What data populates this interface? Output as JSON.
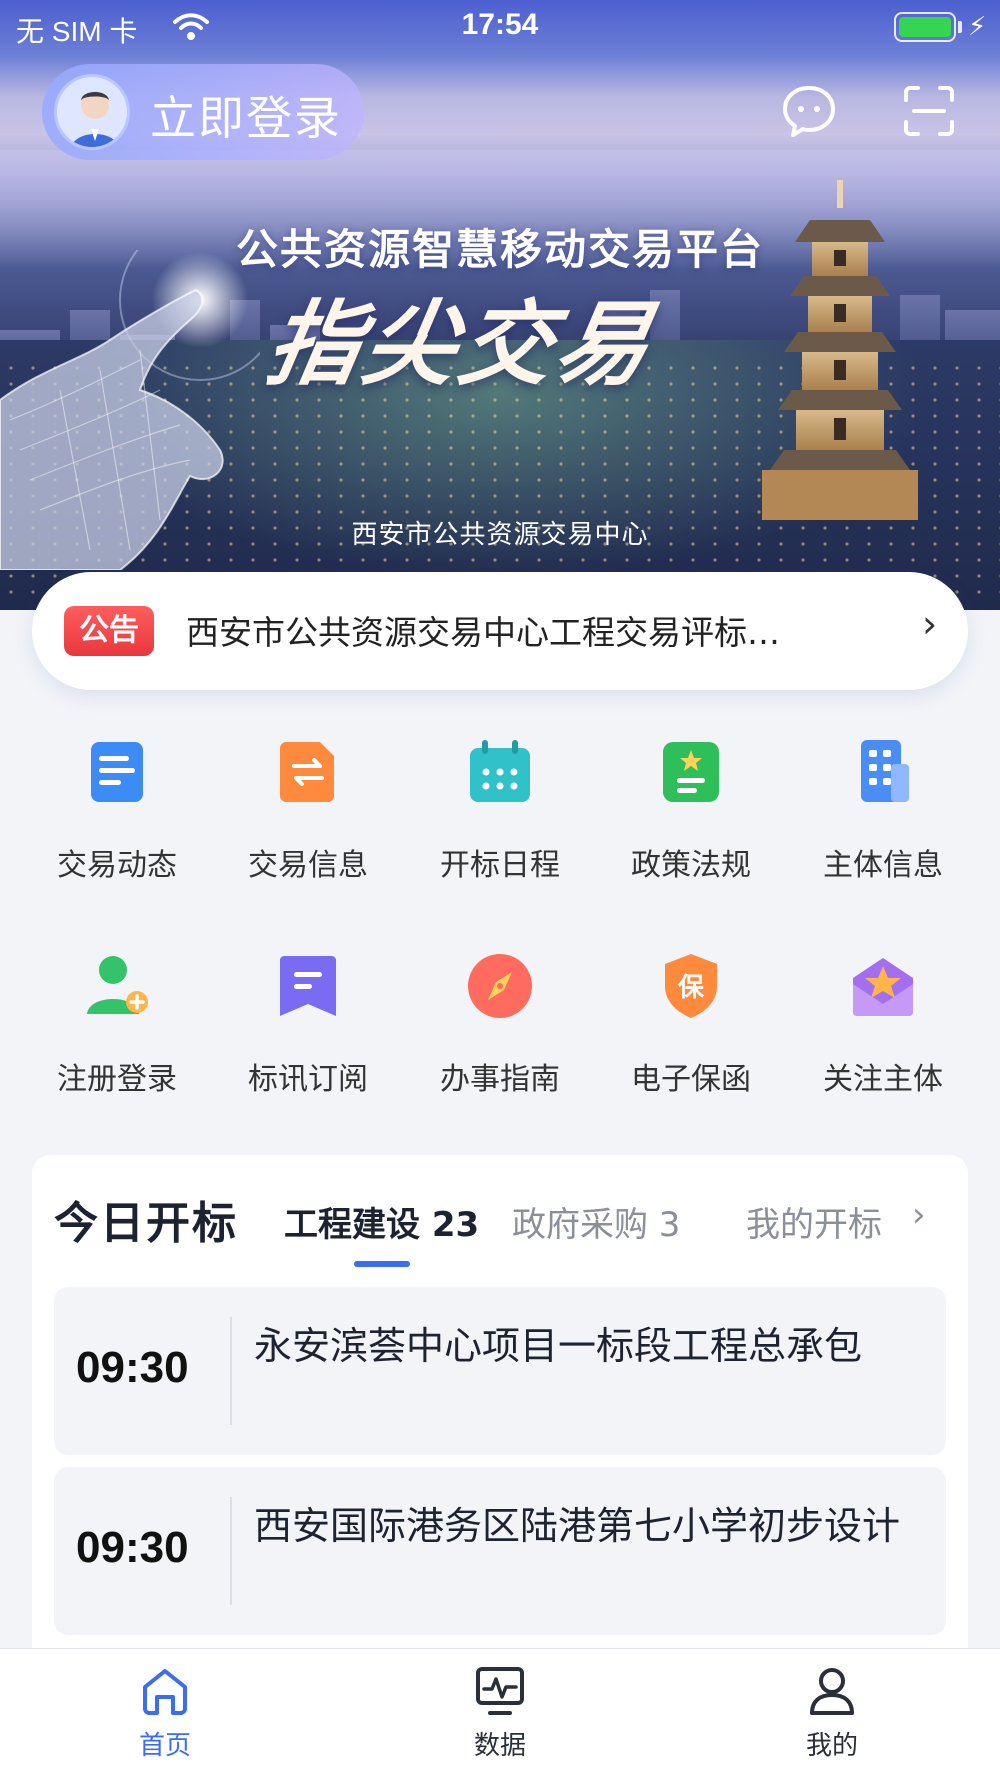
{
  "status_bar": {
    "carrier": "无 SIM 卡",
    "time": "17:54",
    "battery_color": "#35d453"
  },
  "header": {
    "login_label": "立即登录",
    "icons": [
      "message-icon",
      "scan-icon"
    ]
  },
  "banner": {
    "title": "公共资源智慧移动交易平台",
    "slogan": "指尖交易",
    "subtitle": "西安市公共资源交易中心"
  },
  "notice": {
    "badge": "公告",
    "text": "西安市公共资源交易中心工程交易评标…"
  },
  "grid": {
    "items": [
      {
        "label": "交易动态",
        "icon": "news-doc-icon",
        "color": "#3d8cf5"
      },
      {
        "label": "交易信息",
        "icon": "exchange-doc-icon",
        "color": "#ff8a3d"
      },
      {
        "label": "开标日程",
        "icon": "calendar-icon",
        "color": "#30c2c8"
      },
      {
        "label": "政策法规",
        "icon": "policy-badge-icon",
        "color": "#2fbf5a"
      },
      {
        "label": "主体信息",
        "icon": "building-icon",
        "color": "#4b8df6"
      },
      {
        "label": "注册登录",
        "icon": "add-user-icon",
        "color": "#34c26a"
      },
      {
        "label": "标讯订阅",
        "icon": "bookmark-icon",
        "color": "#7a6cf2"
      },
      {
        "label": "办事指南",
        "icon": "compass-icon",
        "color": "#ff6b5e"
      },
      {
        "label": "电子保函",
        "icon": "guarantee-shield-icon",
        "color": "#ff8a3d"
      },
      {
        "label": "关注主体",
        "icon": "star-envelope-icon",
        "color": "#a46ef0"
      }
    ]
  },
  "today": {
    "title": "今日开标",
    "tabs": [
      {
        "label": "工程建设 23",
        "active": true
      },
      {
        "label": "政府采购 3",
        "active": false
      }
    ],
    "mine_link": "我的开标",
    "accent": "#3a6cf4",
    "rows": [
      {
        "time": "09:30",
        "title": "永安滨荟中心项目一标段工程总承包"
      },
      {
        "time": "09:30",
        "title": "西安国际港务区陆港第七小学初步设计"
      }
    ]
  },
  "tabbar": {
    "items": [
      {
        "label": "首页",
        "icon": "home-icon",
        "active": true
      },
      {
        "label": "数据",
        "icon": "chart-monitor-icon",
        "active": false
      },
      {
        "label": "我的",
        "icon": "user-icon",
        "active": false
      }
    ],
    "active_color": "#3a6cf4"
  }
}
